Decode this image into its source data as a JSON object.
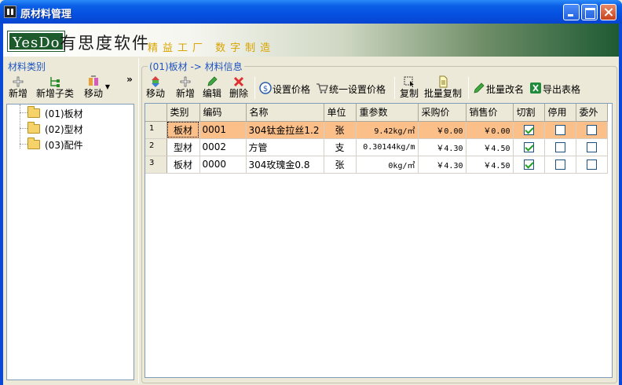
{
  "window": {
    "title": "原材料管理"
  },
  "banner": {
    "logo": "YesDo",
    "brand": "有思度软件",
    "slogan": "精益工厂 数字制造"
  },
  "left": {
    "caption": "材料类别",
    "toolbar": {
      "add": "新增",
      "add_child": "新增子类",
      "move": "移动",
      "more": "»"
    },
    "tree": [
      {
        "label": "(01)板材"
      },
      {
        "label": "(02)型材"
      },
      {
        "label": "(03)配件"
      }
    ]
  },
  "right": {
    "caption": "(01)板材 -> 材料信息",
    "toolbar": {
      "move": "移动",
      "add": "新增",
      "edit": "编辑",
      "delete": "删除",
      "set_price": "设置价格",
      "unified_price": "统一设置价格",
      "copy": "复制",
      "batch_copy": "批量复制",
      "batch_rename": "批量改名",
      "export": "导出表格"
    },
    "columns": [
      "类别",
      "编码",
      "名称",
      "单位",
      "重参数",
      "采购价",
      "销售价",
      "切割",
      "停用",
      "委外"
    ],
    "rows": [
      {
        "no": "1",
        "category": "板材",
        "code": "0001",
        "name": "304钛金拉丝1.2",
        "unit": "张",
        "weight": "9.42kg/㎡",
        "purchase": "￥0.00",
        "sale": "￥0.00",
        "cut": true,
        "disabled": false,
        "outsource": false
      },
      {
        "no": "2",
        "category": "型材",
        "code": "0002",
        "name": "方管",
        "unit": "支",
        "weight": "0.30144kg/m",
        "purchase": "￥4.30",
        "sale": "￥4.50",
        "cut": true,
        "disabled": false,
        "outsource": false
      },
      {
        "no": "3",
        "category": "板材",
        "code": "0000",
        "name": "304玫瑰金0.8",
        "unit": "张",
        "weight": "0kg/㎡",
        "purchase": "￥4.30",
        "sale": "￥4.50",
        "cut": true,
        "disabled": false,
        "outsource": false
      }
    ],
    "selected_row": 0
  },
  "colors": {
    "selected_row": "#FBC08A",
    "caption": "#1f56c4",
    "banner_dark": "#1e5a33"
  }
}
